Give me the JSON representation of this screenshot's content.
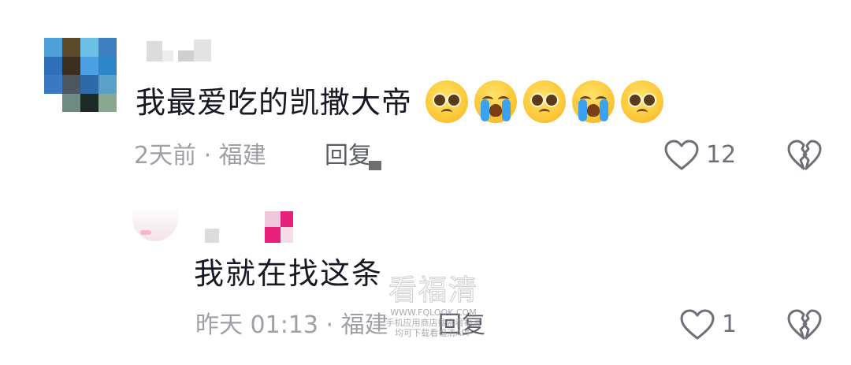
{
  "comment": {
    "text": "我最爱吃的凯撒大帝",
    "emojis": [
      "pleading-face",
      "loudly-crying-face",
      "pleading-face",
      "loudly-crying-face",
      "pleading-face"
    ],
    "meta": "2天前 · 福建",
    "reply_label": "回复",
    "like_count": "12"
  },
  "reply": {
    "text": "我就在找这条",
    "meta": "昨天 01:13 · 福建",
    "reply_label": "回复",
    "like_count": "1"
  },
  "watermark": {
    "title": "看福清",
    "url": "WWW.FQLOOK.COM",
    "line1": "手机应用商店搜索看福清",
    "line2": "均可下载看福清APP"
  },
  "colors": {
    "text": "#161823",
    "meta": "#9ea0a6",
    "icon": "#6e7079"
  }
}
